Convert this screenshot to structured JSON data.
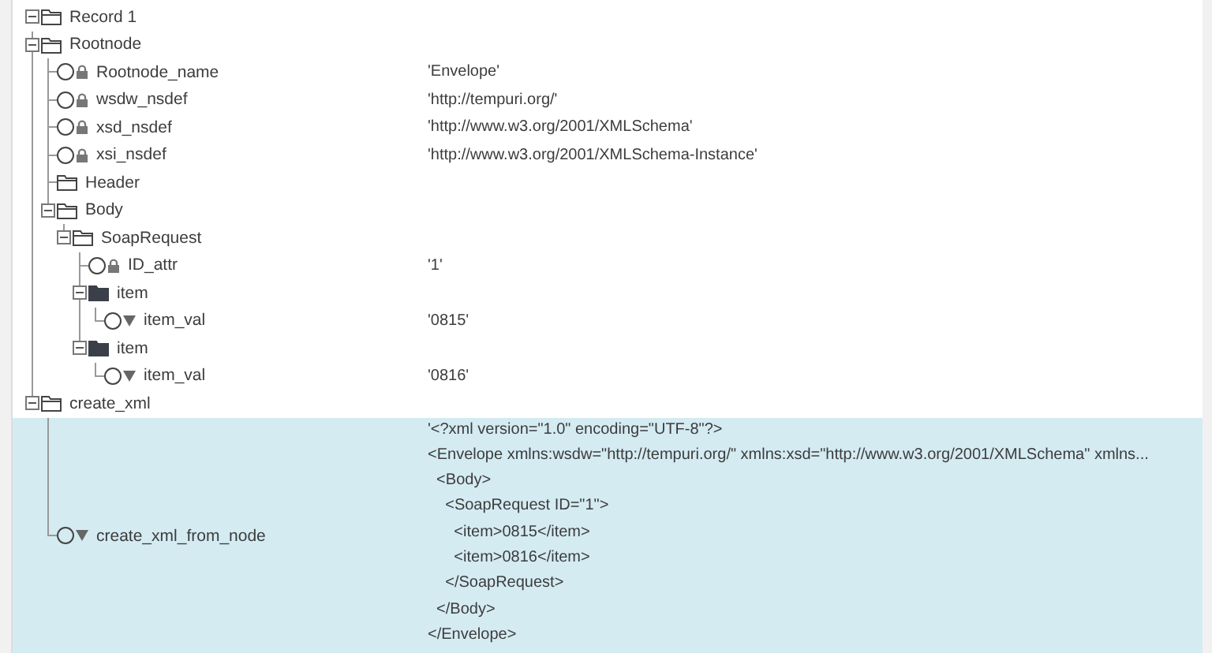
{
  "tree": [
    {
      "kind": "folder",
      "label": "Record 1",
      "expanded": true,
      "selected": false,
      "children": [
        {
          "kind": "folder",
          "label": "Rootnode",
          "expanded": true,
          "selected": false,
          "children": [
            {
              "kind": "attribute",
              "label": "Rootnode_name",
              "value": "'Envelope'",
              "selected": false
            },
            {
              "kind": "attribute",
              "label": "wsdw_nsdef",
              "value": "'http://tempuri.org/'",
              "selected": false
            },
            {
              "kind": "attribute",
              "label": "xsd_nsdef",
              "value": "'http://www.w3.org/2001/XMLSchema'",
              "selected": false
            },
            {
              "kind": "attribute",
              "label": "xsi_nsdef",
              "value": "'http://www.w3.org/2001/XMLSchema-Instance'",
              "selected": false
            },
            {
              "kind": "folder",
              "label": "Header",
              "selected": false
            },
            {
              "kind": "folder",
              "label": "Body",
              "expanded": true,
              "selected": false,
              "children": [
                {
                  "kind": "folder",
                  "label": "SoapRequest",
                  "expanded": true,
                  "selected": false,
                  "children": [
                    {
                      "kind": "attribute",
                      "label": "ID_attr",
                      "value": "'1'",
                      "selected": false
                    },
                    {
                      "kind": "group",
                      "label": "item",
                      "expanded": true,
                      "selected": false,
                      "children": [
                        {
                          "kind": "element",
                          "label": "item_val",
                          "value": "'0815'",
                          "selected": false
                        }
                      ]
                    },
                    {
                      "kind": "group",
                      "label": "item",
                      "expanded": true,
                      "selected": false,
                      "children": [
                        {
                          "kind": "element",
                          "label": "item_val",
                          "value": "'0816'",
                          "selected": false
                        }
                      ]
                    }
                  ]
                }
              ]
            }
          ]
        },
        {
          "kind": "folder",
          "label": "create_xml",
          "expanded": true,
          "selected": false,
          "children": [
            {
              "kind": "element",
              "label": "create_xml_from_node",
              "selected": true,
              "value_lines": [
                "'<?xml version=\"1.0\" encoding=\"UTF-8\"?>",
                "<Envelope xmlns:wsdw=\"http://tempuri.org/\" xmlns:xsd=\"http://www.w3.org/2001/XMLSchema\" xmlns...",
                "  <Body>",
                "    <SoapRequest ID=\"1\">",
                "      <item>0815</item>",
                "      <item>0816</item>",
                "    </SoapRequest>",
                "  </Body>",
                "</Envelope>"
              ]
            }
          ]
        }
      ]
    }
  ]
}
